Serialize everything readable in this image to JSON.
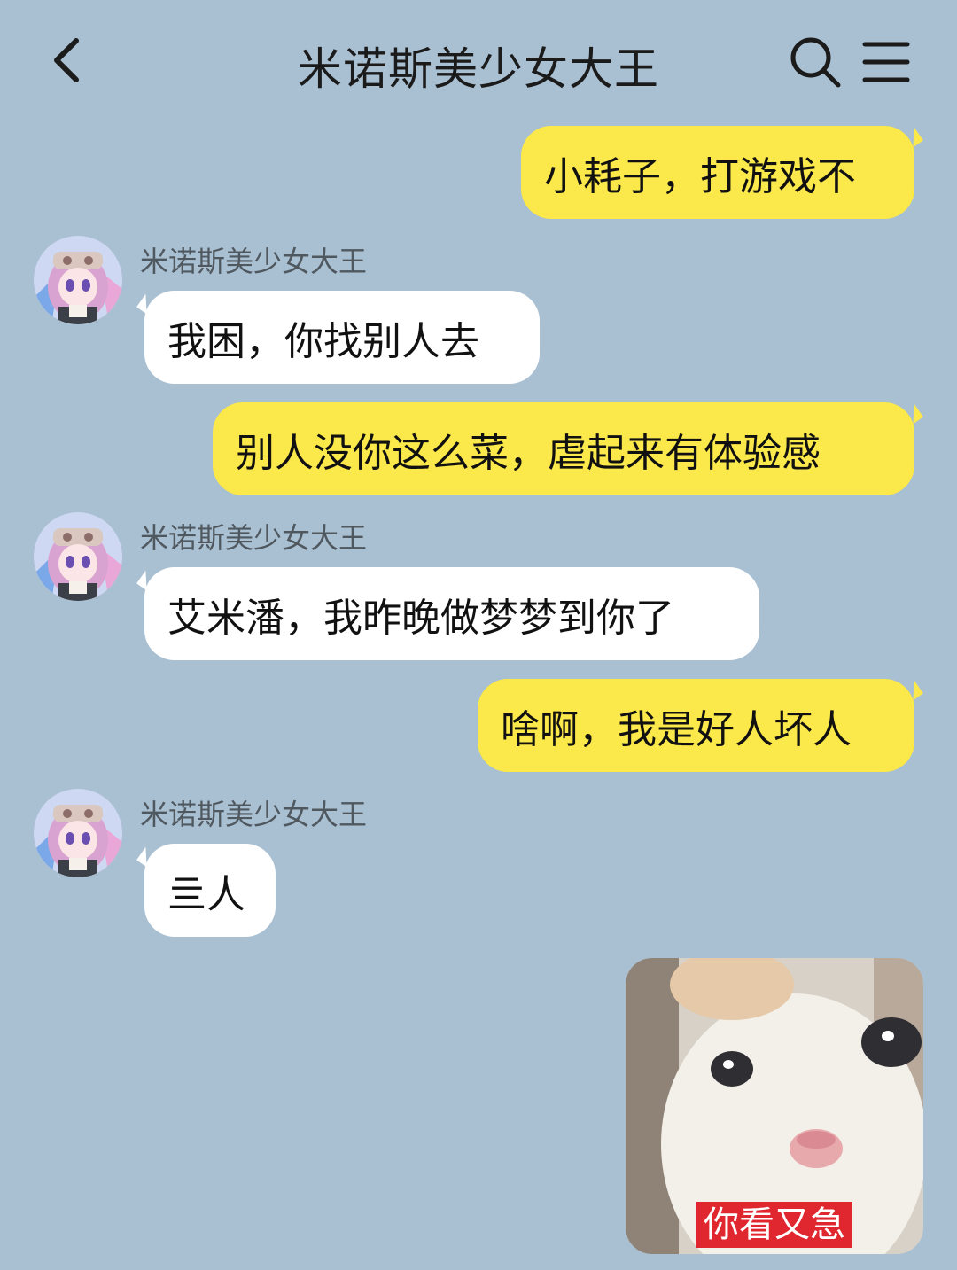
{
  "header": {
    "title": "米诺斯美少女大王",
    "back_icon": "chevron-left-icon",
    "search_icon": "search-icon",
    "menu_icon": "menu-icon"
  },
  "contact": {
    "name": "米诺斯美少女大王"
  },
  "messages": [
    {
      "direction": "out",
      "text": "小耗子，打游戏不"
    },
    {
      "direction": "in",
      "sender": "米诺斯美少女大王",
      "text": "我困，你找别人去"
    },
    {
      "direction": "out",
      "text": "别人没你这么菜，虐起来有体验感"
    },
    {
      "direction": "in",
      "sender": "米诺斯美少女大王",
      "text": "艾米潘，我昨晚做梦梦到你了"
    },
    {
      "direction": "out",
      "text": "啥啊，我是好人坏人"
    },
    {
      "direction": "in",
      "sender": "米诺斯美少女大王",
      "text": "亖人"
    },
    {
      "direction": "out",
      "type": "sticker",
      "caption": "你看又急"
    }
  ],
  "colors": {
    "background": "#a9bfd2",
    "outgoing_bubble": "#fbe84a",
    "incoming_bubble": "#ffffff",
    "sticker_caption_bg": "#e0262f"
  }
}
